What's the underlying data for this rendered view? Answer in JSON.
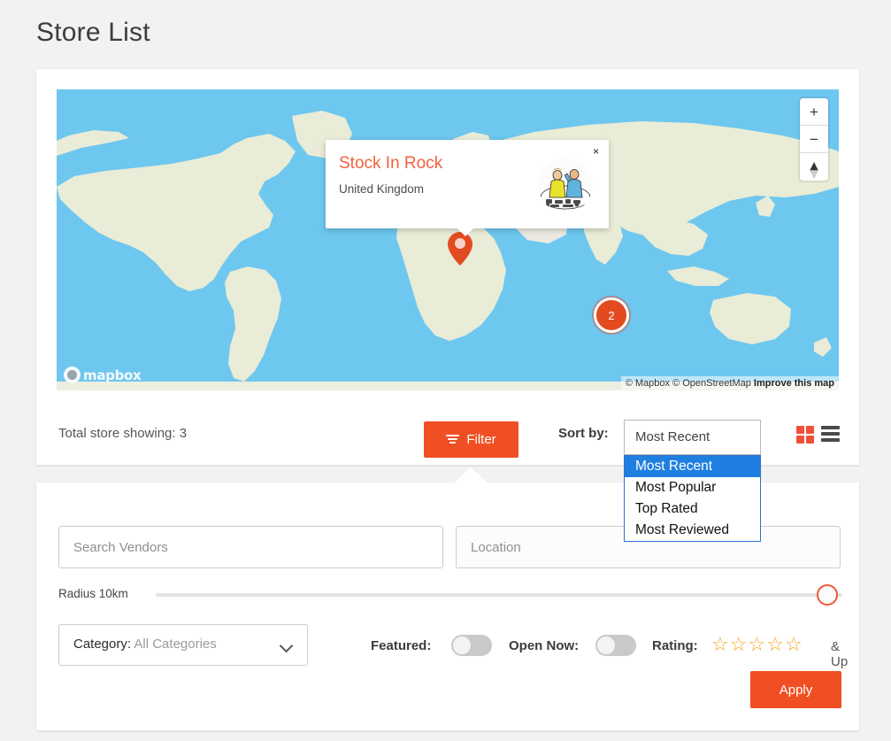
{
  "page": {
    "title": "Store List"
  },
  "map": {
    "popup": {
      "title": "Stock In Rock",
      "subtitle": "United Kingdom",
      "close_label": "×",
      "thumb_icon": "store-avatar-icon"
    },
    "controls": {
      "zoom_in": "+",
      "zoom_out": "−",
      "compass_up": "▲",
      "compass_down": "▼"
    },
    "cluster_count": "2",
    "logo_text": "mapbox",
    "attribution": {
      "copyright": "© Mapbox © OpenStreetMap",
      "improve": "Improve this map"
    },
    "colors": {
      "water": "#6ec7ef",
      "land": "#e9ecd6",
      "marker": "#e24a20"
    }
  },
  "toolbar": {
    "total_text": "Total store showing: 3",
    "filter_label": "Filter",
    "sort_label": "Sort by:",
    "sort_selected": "Most Recent",
    "sort_options": [
      "Most Recent",
      "Most Popular",
      "Top Rated",
      "Most Reviewed"
    ],
    "view_grid_icon": "grid-view-icon",
    "view_list_icon": "list-view-icon",
    "accent_color": "#f04f23"
  },
  "filters": {
    "search_placeholder": "Search Vendors",
    "search_value": "",
    "location_placeholder": "Location",
    "location_value": "",
    "radius_label": "Radius 10km",
    "radius_value": "10",
    "category_label": "Category:",
    "category_value": "All Categories",
    "featured_label": "Featured:",
    "featured_on": false,
    "open_now_label": "Open Now:",
    "open_now_on": false,
    "rating_label": "Rating:",
    "rating_value": "0",
    "rating_stars": [
      "☆",
      "☆",
      "☆",
      "☆",
      "☆"
    ],
    "and_up_label": "& Up",
    "apply_label": "Apply"
  }
}
